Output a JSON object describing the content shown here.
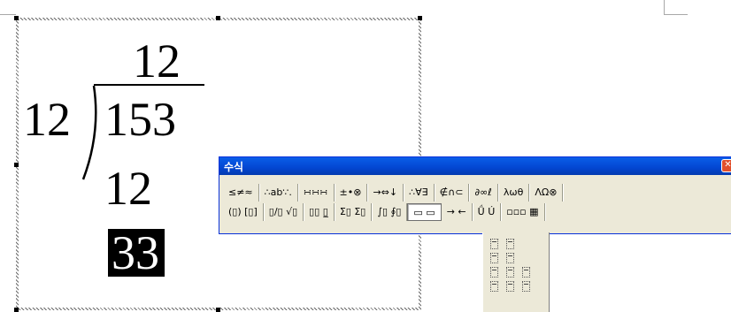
{
  "equation": {
    "quotient": "12",
    "divisor": "12",
    "dividend": "153",
    "subtrahend": "12",
    "remainder": "33"
  },
  "equation_window": {
    "title": "수식",
    "close_label": "✕",
    "row1": [
      "≤≠≈",
      "∴ab∵.",
      "∺∺∺",
      "±•⊗",
      "→⇔↓",
      "∴∀∃",
      "∉∩⊂",
      "∂∞ℓ",
      "λωθ",
      "ΛΩ⊗"
    ],
    "row2": [
      "(▯) [▯]",
      "▯/▯ √▯",
      "▯▯ ▯̲",
      "Σ▯ Σ▯",
      "∫▯ ∮▯",
      "▭ ▭",
      "→ ←",
      "Ǘ Ú",
      "▫▫▫ ▦"
    ],
    "selected_row2_index": 5
  },
  "palette": {
    "rows": [
      2,
      2,
      3,
      3
    ]
  }
}
